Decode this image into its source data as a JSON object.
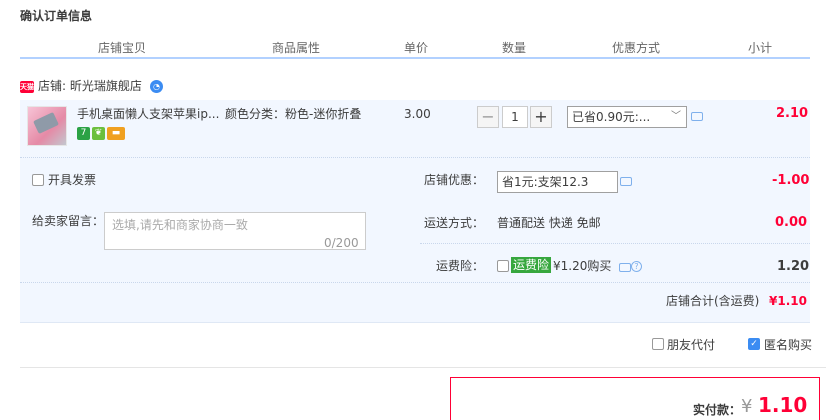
{
  "section_title": "确认订单信息",
  "columns": [
    "店铺宝贝",
    "商品属性",
    "单价",
    "数量",
    "优惠方式",
    "小计"
  ],
  "shop": {
    "label": "店铺: 昕光瑞旗舰店"
  },
  "item": {
    "title": "手机桌面懒人支架苹果ip...",
    "attr": "颜色分类：粉色-迷你折叠",
    "price": "3.00",
    "qty": "1",
    "qty_minus": "−",
    "qty_plus": "+",
    "discount": "已省0.90元:...",
    "subtotal": "2.10",
    "badges": [
      "7"
    ]
  },
  "invoice": {
    "label": "开具发票"
  },
  "message": {
    "label": "给卖家留言：",
    "placeholder": "选填,请先和商家协商一致",
    "count": "0/200"
  },
  "shop_discount": {
    "label": "店铺优惠：",
    "select": "省1元:支架12.3",
    "value": "-1.00"
  },
  "shipping": {
    "label": "运送方式：",
    "value": "普通配送 快递 免邮",
    "cost": "0.00"
  },
  "insurance": {
    "label": "运费险：",
    "tag": "运费险",
    "text": "¥1.20购买",
    "value": "1.20",
    "help": "?"
  },
  "shop_total": {
    "label": "店铺合计(含运费)",
    "value": "¥1.10"
  },
  "options": {
    "friend_pay": "朋友代付",
    "anonymous": "匿名购买",
    "anonymous_checked": true
  },
  "payment": {
    "label": "实付款：",
    "currency": "¥",
    "amount": "1.10"
  },
  "colors": {
    "accent": "#ff0036",
    "header_line": "#b2d1ff",
    "panel": "#f2f7ff",
    "insurance_tag": "#37a73e",
    "checkbox": "#3b8cf2"
  },
  "icons": [
    "tmall-icon",
    "shop-badge-icon",
    "chevron-down-icon",
    "chat-bubble-icon",
    "help-icon",
    "check-icon"
  ]
}
